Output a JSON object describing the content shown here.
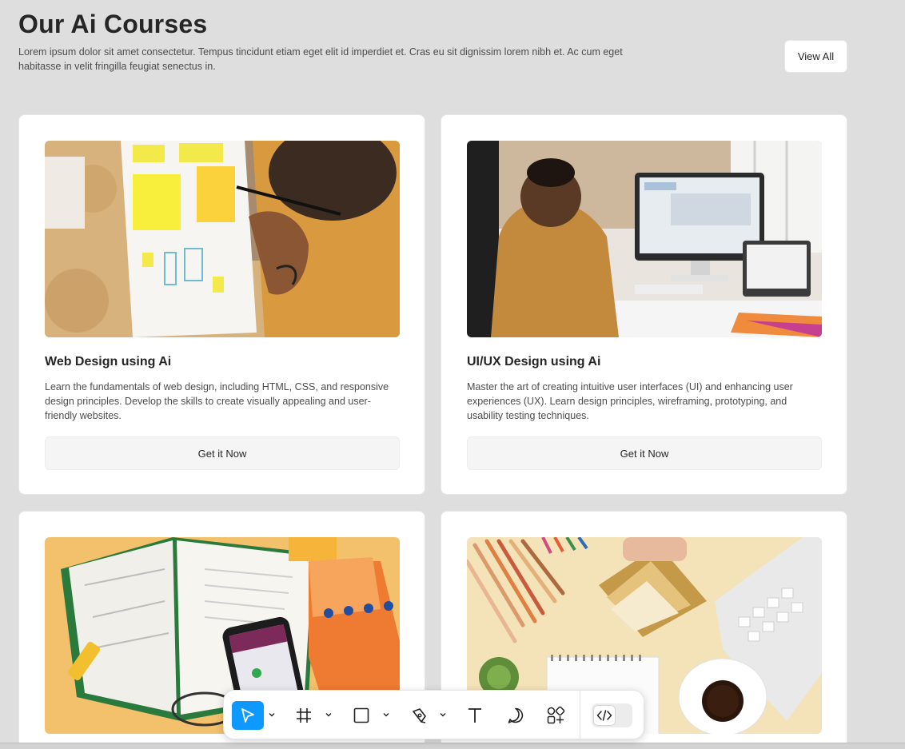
{
  "section": {
    "title": "Our Ai Courses",
    "intro": "Lorem ipsum dolor sit amet consectetur. Tempus tincidunt etiam eget elit id imperdiet et. Cras eu sit dignissim lorem nibh et. Ac cum eget habitasse in velit fringilla feugiat senectus in.",
    "view_all_label": "View All"
  },
  "courses": [
    {
      "title": "Web Design using Ai",
      "description": "Learn the fundamentals of web design, including HTML, CSS, and responsive design principles. Develop the skills to create visually appealing and user-friendly websites.",
      "button_label": "Get it Now"
    },
    {
      "title": "UI/UX Design using Ai",
      "description": "Master the art of creating intuitive user interfaces (UI) and enhancing user experiences (UX). Learn design principles, wireframing, prototyping, and usability testing techniques.",
      "button_label": "Get it Now"
    },
    {
      "title": "",
      "description": "",
      "button_label": ""
    },
    {
      "title": "",
      "description": "",
      "button_label": ""
    }
  ],
  "toolbar": {
    "tools": [
      "move-tool",
      "frame-tool",
      "rectangle-tool",
      "pen-tool",
      "text-tool",
      "comment-tool",
      "actions-tool"
    ],
    "active_tool": "move-tool",
    "accent": "#0d99ff",
    "dev_mode_icon": "code-icon"
  }
}
